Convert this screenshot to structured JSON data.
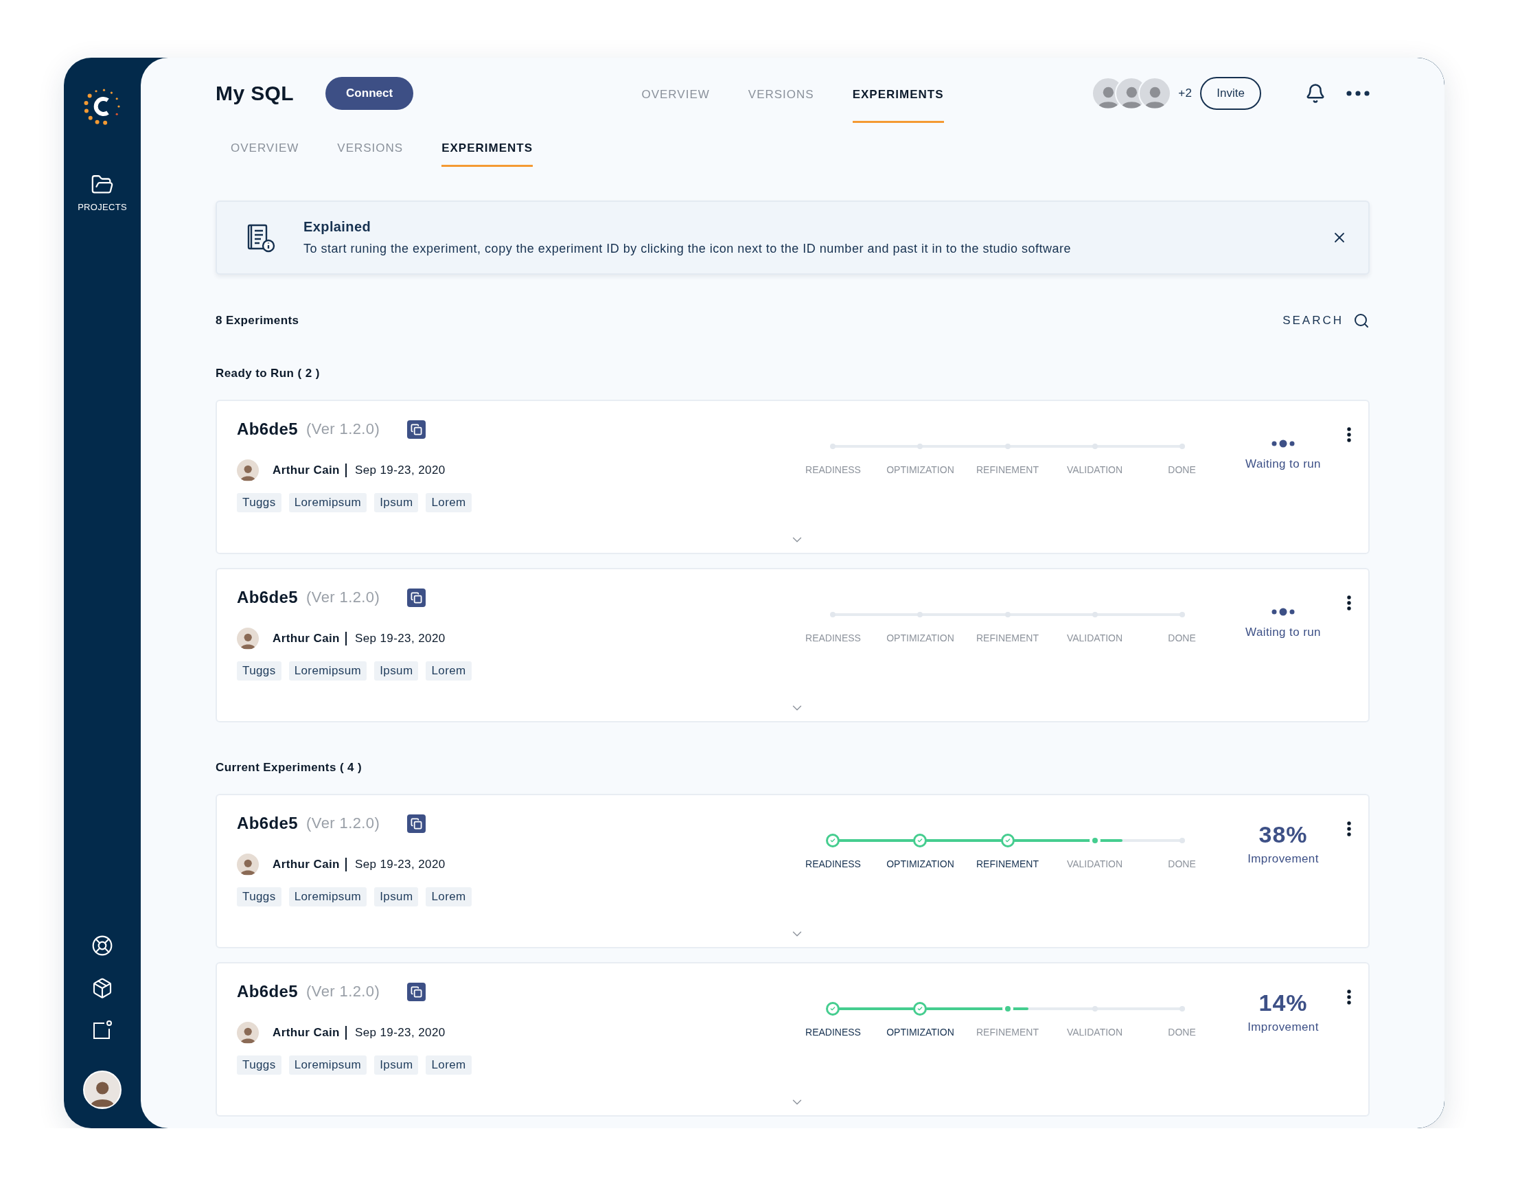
{
  "sidebar": {
    "nav_items": [
      {
        "label": "PROJECTS"
      }
    ]
  },
  "header": {
    "title": "My SQL",
    "connect_button": "Connect",
    "tabs": [
      {
        "label": "OVERVIEW",
        "selected": false
      },
      {
        "label": "VERSIONS",
        "selected": false
      },
      {
        "label": "EXPERIMENTS",
        "selected": true
      }
    ],
    "collaborators_extra": "+2",
    "invite_button": "Invite"
  },
  "sub_tabs": [
    {
      "label": "OVERVIEW",
      "selected": false
    },
    {
      "label": "VERSIONS",
      "selected": false
    },
    {
      "label": "EXPERIMENTS",
      "selected": true
    }
  ],
  "banner": {
    "title": "Explained",
    "text": "To start runing the experiment, copy the experiment ID by clicking the icon next to the ID number and past it in to the studio software"
  },
  "experiments_count": "8 Experiments",
  "search_label": "SEARCH",
  "groups": [
    {
      "title": "Ready to Run ( 2 )",
      "experiments": [
        {
          "id": "Ab6de5",
          "version": "(Ver 1.2.0)",
          "owner": "Arthur Cain",
          "date": "Sep 19-23, 2020",
          "tags": [
            "Tuggs",
            "Loremipsum",
            "Ipsum",
            "Lorem"
          ],
          "progress": {
            "stages": [
              {
                "label": "READINESS",
                "done": false,
                "current": false
              },
              {
                "label": "OPTIMIZATION",
                "done": false,
                "current": false
              },
              {
                "label": "REFINEMENT",
                "done": false,
                "current": false
              },
              {
                "label": "VALIDATION",
                "done": false,
                "current": false
              },
              {
                "label": "DONE",
                "done": false,
                "current": false
              }
            ]
          },
          "status": {
            "kind": "waiting",
            "text": "Waiting to run"
          }
        },
        {
          "id": "Ab6de5",
          "version": "(Ver 1.2.0)",
          "owner": "Arthur Cain",
          "date": "Sep 19-23, 2020",
          "tags": [
            "Tuggs",
            "Loremipsum",
            "Ipsum",
            "Lorem"
          ],
          "progress": {
            "stages": [
              {
                "label": "READINESS",
                "done": false,
                "current": false
              },
              {
                "label": "OPTIMIZATION",
                "done": false,
                "current": false
              },
              {
                "label": "REFINEMENT",
                "done": false,
                "current": false
              },
              {
                "label": "VALIDATION",
                "done": false,
                "current": false
              },
              {
                "label": "DONE",
                "done": false,
                "current": false
              }
            ]
          },
          "status": {
            "kind": "waiting",
            "text": "Waiting to run"
          }
        }
      ]
    },
    {
      "title": "Current Experiments ( 4 )",
      "experiments": [
        {
          "id": "Ab6de5",
          "version": "(Ver 1.2.0)",
          "owner": "Arthur Cain",
          "date": "Sep 19-23, 2020",
          "tags": [
            "Tuggs",
            "Loremipsum",
            "Ipsum",
            "Lorem"
          ],
          "progress": {
            "level": 0.83,
            "stages": [
              {
                "label": "READINESS",
                "done": true,
                "current": false
              },
              {
                "label": "OPTIMIZATION",
                "done": true,
                "current": false
              },
              {
                "label": "REFINEMENT",
                "done": true,
                "current": false
              },
              {
                "label": "VALIDATION",
                "done": false,
                "current": true
              },
              {
                "label": "DONE",
                "done": false,
                "current": false
              }
            ]
          },
          "status": {
            "kind": "improvement",
            "value": "38%",
            "text": "Improvement"
          }
        },
        {
          "id": "Ab6de5",
          "version": "(Ver 1.2.0)",
          "owner": "Arthur Cain",
          "date": "Sep 19-23, 2020",
          "tags": [
            "Tuggs",
            "Loremipsum",
            "Ipsum",
            "Lorem"
          ],
          "progress": {
            "level": 0.56,
            "stages": [
              {
                "label": "READINESS",
                "done": true,
                "current": false
              },
              {
                "label": "OPTIMIZATION",
                "done": true,
                "current": false
              },
              {
                "label": "REFINEMENT",
                "done": false,
                "current": true
              },
              {
                "label": "VALIDATION",
                "done": false,
                "current": false
              },
              {
                "label": "DONE",
                "done": false,
                "current": false
              }
            ]
          },
          "status": {
            "kind": "improvement",
            "value": "14%",
            "text": "Improvement"
          }
        }
      ]
    }
  ]
}
